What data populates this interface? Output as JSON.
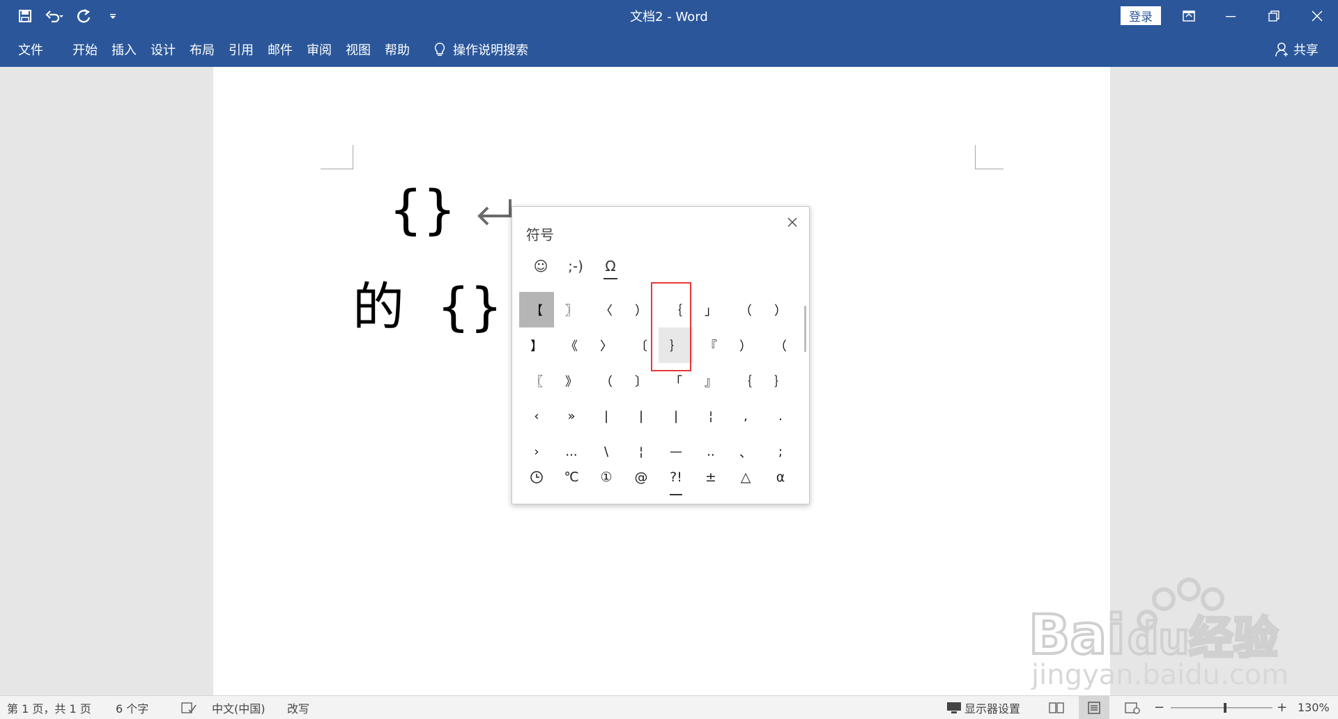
{
  "titlebar": {
    "title": "文档2  -  Word",
    "login_label": "登录"
  },
  "menu": {
    "items": [
      "文件",
      "开始",
      "插入",
      "设计",
      "布局",
      "引用",
      "邮件",
      "审阅",
      "视图",
      "帮助"
    ],
    "tell_me": "操作说明搜索",
    "share": "共享"
  },
  "document": {
    "line1": "{}",
    "line2": "的  {}"
  },
  "symbol_panel": {
    "title": "符号",
    "tabs": [
      "☺",
      ";-)",
      "Ω"
    ],
    "active_tab": 2,
    "grid": [
      [
        "【",
        "〗",
        "〈",
        "）",
        "｛",
        "」",
        "（",
        "）"
      ],
      [
        "】",
        "《",
        "〉",
        "〔",
        "｝",
        "『",
        "）",
        "（"
      ],
      [
        "〖",
        "》",
        "（",
        "〕",
        "「",
        "』",
        "｛",
        "｝"
      ],
      [
        "‹",
        "»",
        "|",
        "|",
        "|",
        "¦",
        ",",
        "."
      ],
      [
        "›",
        "...",
        "\\",
        "¦",
        "—",
        "..",
        "、",
        ";"
      ]
    ],
    "selected_cell": "【",
    "hovered_cell": "｝",
    "categories": [
      "🕒",
      "℃",
      "①",
      "@",
      "?!",
      "±",
      "△",
      "α"
    ],
    "active_category": 4
  },
  "statusbar": {
    "page": "第 1 页，共 1 页",
    "words": "6 个字",
    "language": "中文(中国)",
    "mode": "改写",
    "display_settings": "显示器设置",
    "zoom": "130%",
    "zoom_level": 130
  },
  "watermark": {
    "brand": "Bai",
    "brand2": "du",
    "brand_cn": "经验",
    "url": "jingyan.baidu.com"
  },
  "colors": {
    "accent": "#2b579a",
    "highlight_box": "#e53935"
  }
}
